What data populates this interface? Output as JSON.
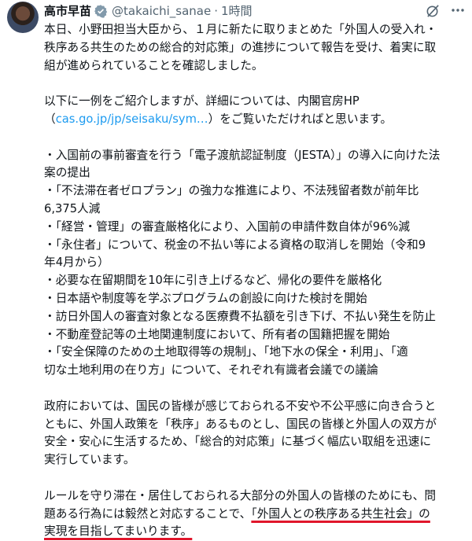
{
  "author": {
    "name": "高市早苗",
    "handle": "@takaichi_sanae",
    "separator": "·",
    "time": "1時間"
  },
  "icons": [
    "verified-badge-icon",
    "grok-icon",
    "more-icon"
  ],
  "colors": {
    "link": "#1d9bf0",
    "highlight": "#e0162b",
    "secondary": "#536471"
  },
  "tweet": {
    "p1": [
      "本日、小野田担当大臣から、１月に新たに取りまとめた「外国人の受入れ・",
      "秩序ある共生のための総合的対応策」の進捗について報告を受け、着実に取",
      "組が進められていることを確認しました。"
    ],
    "p2_line1": "以下に一例をご紹介しますが、詳細については、内閣官房HP",
    "p2_open": "（",
    "p2_link": "cas.go.jp/jp/seisaku/sym…",
    "p2_close": "）をご覧いただければと思います。",
    "bullets": [
      "・入国前の事前審査を行う「電子渡航認証制度（JESTA）」の導入に向けた法",
      "案の提出",
      "・「不法滞在者ゼロプラン」の強力な推進により、不法残留者数が前年比",
      "6,375人減",
      "・「経営・管理」の審査厳格化により、入国前の申請件数自体が96%減",
      "・「永住者」について、税金の不払い等による資格の取消しを開始（令和9",
      "年4月から）",
      "・必要な在留期間を10年に引き上げるなど、帰化の要件を厳格化",
      "・日本語や制度等を学ぶプログラムの創設に向けた検討を開始",
      "・訪日外国人の審査対象となる医療費不払額を引き下げ、不払い発生を防止",
      "・不動産登記等の土地関連制度において、所有者の国籍把握を開始",
      "・「安全保障のための土地取得等の規制」、「地下水の保全・利用」、「適",
      "切な土地利用の在り方」について、それぞれ有識者会議での議論"
    ],
    "p3": [
      "政府においては、国民の皆様が感じておられる不安や不公平感に向き合うと",
      "ともに、外国人政策を「秩序」あるものとし、国民の皆様と外国人の双方が",
      "安全・安心に生活するため、「総合的対応策」に基づく幅広い取組を迅速に",
      "実行しています。"
    ],
    "p4_line1": "ルールを守り滞在・居住しておられる大部分の外国人の皆様のためにも、問",
    "p4_line2_plain": "題ある行為には毅然と対応することで、",
    "p4_line2_marked": "「外国人との秩序ある共生社会」の",
    "p4_line3_marked": "実現を目指してまいります。"
  }
}
